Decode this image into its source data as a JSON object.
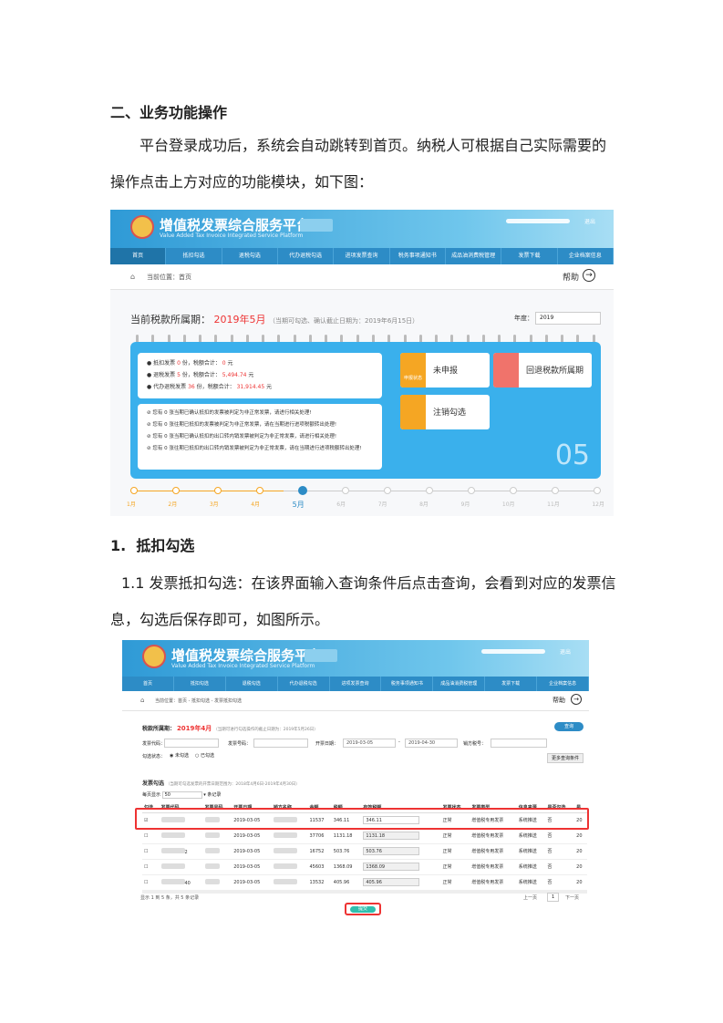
{
  "doc": {
    "heading": "二、业务功能操作",
    "intro": "平台登录成功后，系统会自动跳转到首页。纳税人可根据自己实际需要的操作点击上方对应的功能模块，如下图：",
    "section_num": "1.",
    "section_title": "抵扣勾选",
    "desc": "1.1 发票抵扣勾选：在该界面输入查询条件后点击查询，会看到对应的发票信息，勾选后保存即可，如图所示。"
  },
  "platform": {
    "title": "增值税发票综合服务平台",
    "subtitle": "Value Added Tax Invoice Integrated Service Platform",
    "exit": "退出",
    "nav": [
      "首页",
      "抵扣勾选",
      "退税勾选",
      "代办退税勾选",
      "进项发票查询",
      "税务事项通知书",
      "成品油消费税管理",
      "发票下载",
      "企业档案信息"
    ]
  },
  "home": {
    "breadcrumb": "当前位置：首页",
    "help": "帮助",
    "period_label": "当前税款所属期：",
    "period_value": "2019年5月",
    "period_note": "（当期可勾选、确认截止日期为：2019年6月15日）",
    "year_label": "年度：",
    "year_value": "2019",
    "stats": [
      {
        "pre": "抵扣发票",
        "n": "0",
        "mid": "份，税额合计：",
        "amt": "0",
        "unit": "元"
      },
      {
        "pre": "退税发票",
        "n": "5",
        "mid": "份，税额合计：",
        "amt": "5,494.74",
        "unit": "元"
      },
      {
        "pre": "代办退税发票",
        "n": "36",
        "mid": "份，税额合计：",
        "amt": "31,914.45",
        "unit": "元"
      }
    ],
    "notices": [
      "您有 0 张当期已确认抵扣的发票被判定为非正常发票，请进行相关处理!",
      "您有 0 张往期已抵扣的发票被判定为非正常发票，请在当期进行进项税额转出处理!",
      "您有 0 张当期已确认抵扣的出口转内销发票被判定为非正常发票，请进行相关处理!",
      "您有 0 张往期已抵扣的出口转内销发票被判定为非正常发票，请在当期进行进项税额转出处理!"
    ],
    "btn_undeclared": "未申报",
    "btn_undeclared_icon": "申报状态",
    "btn_back": "回退税款所属期",
    "btn_logout": "注销勾选",
    "big_month": "05",
    "months": [
      "1月",
      "2月",
      "3月",
      "4月",
      "5月",
      "6月",
      "7月",
      "8月",
      "9月",
      "10月",
      "11月",
      "12月"
    ],
    "colors": {
      "accent": "#2d8cc6",
      "panel": "#3ab0ec",
      "orange": "#f5a623",
      "red": "#e33333"
    }
  },
  "deduct": {
    "breadcrumb": "当前位置：首页 - 抵扣勾选 - 发票抵扣勾选",
    "help": "帮助",
    "period_label": "税款所属期：",
    "period_value": "2019年4月",
    "period_note": "（当期可进行勾选操作的截止日期为：2019年5月26日）",
    "f_code": "发票代码：",
    "f_no": "发票号码：",
    "f_date": "开票日期：",
    "date_from": "2019-03-05",
    "date_to": "2019-04-30",
    "f_seller": "销方税号：",
    "f_state": "勾选状态：",
    "opt1": "未勾选",
    "opt2": "已勾选",
    "query": "查询",
    "more": "更多查询条件",
    "list_title": "发票勾选",
    "list_note": "（当期可勾选发票的开票日期范围为：2018年4月6日-2019年4月30日）",
    "per_page_pre": "每页显示",
    "per_page": "50",
    "per_page_post": "条记录",
    "cols": [
      "勾选",
      "发票代码",
      "发票号码",
      "开票日期",
      "销方名称",
      "金额",
      "税额",
      "有效税额",
      "发票状态",
      "发票类型",
      "信息来源",
      "是否勾选",
      "是"
    ],
    "rows": [
      {
        "date": "2019-03-05",
        "amt": "11537",
        "tax": "346.11",
        "valid": "346.11",
        "state": "正常",
        "type": "增值税专用发票",
        "src": "系统推送",
        "chk": "否",
        "x": "20",
        "code_tail": "",
        "checked": "☑"
      },
      {
        "date": "2019-03-05",
        "amt": "37706",
        "tax": "1131.18",
        "valid": "1131.18",
        "state": "正常",
        "type": "增值税专用发票",
        "src": "系统推送",
        "chk": "否",
        "x": "20",
        "code_tail": "",
        "checked": "☐"
      },
      {
        "date": "2019-03-05",
        "amt": "16752",
        "tax": "503.76",
        "valid": "503.76",
        "state": "正常",
        "type": "增值税专用发票",
        "src": "系统推送",
        "chk": "否",
        "x": "20",
        "code_tail": "2",
        "checked": "☐"
      },
      {
        "date": "2019-03-05",
        "amt": "45603",
        "tax": "1368.09",
        "valid": "1368.09",
        "state": "正常",
        "type": "增值税专用发票",
        "src": "系统推送",
        "chk": "否",
        "x": "20",
        "code_tail": "",
        "checked": "☐"
      },
      {
        "date": "2019-03-05",
        "amt": "13532",
        "tax": "405.96",
        "valid": "405.96",
        "state": "正常",
        "type": "增值税专用发票",
        "src": "系统推送",
        "chk": "否",
        "x": "20",
        "code_tail": "40",
        "checked": "☐"
      }
    ],
    "footer": "显示 1 到 5 条，共 5 条记录",
    "prev": "上一页",
    "page": "1",
    "next": "下一页",
    "submit": "提交"
  }
}
